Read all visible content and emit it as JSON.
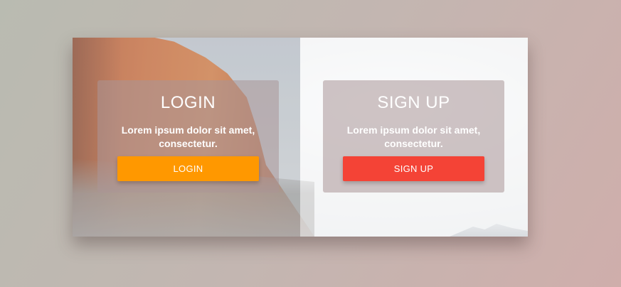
{
  "login": {
    "title": "LOGIN",
    "description": "Lorem ipsum dolor sit amet, consectetur.",
    "button_label": "LOGIN",
    "button_color": "#ff9800"
  },
  "signup": {
    "title": "SIGN UP",
    "description": "Lorem ipsum dolor sit amet, consectetur.",
    "button_label": "SIGN UP",
    "button_color": "#f44336"
  }
}
